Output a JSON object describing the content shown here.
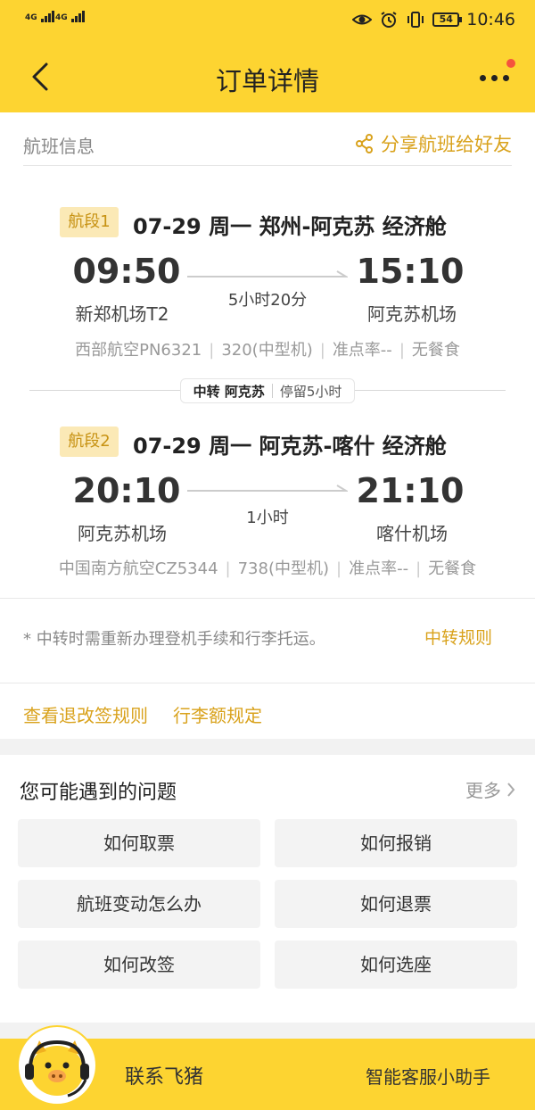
{
  "status_bar": {
    "signal_1": "4G",
    "signal_2": "4G",
    "battery": "54",
    "time": "10:46",
    "icons": [
      "eye-icon",
      "alarm-icon",
      "vibrate-icon"
    ]
  },
  "header": {
    "title": "订单详情"
  },
  "flight_info": {
    "title": "航班信息",
    "share_label": "分享航班给好友"
  },
  "segments": [
    {
      "badge": "航段1",
      "headline": "07-29  周一  郑州-阿克苏  经济舱",
      "dep_time": "09:50",
      "dep_airport": "新郑机场T2",
      "arr_time": "15:10",
      "arr_airport": "阿克苏机场",
      "duration": "5小时20分",
      "airline": "西部航空PN6321",
      "aircraft": "320(中型机)",
      "on_time": "准点率--",
      "meal": "无餐食"
    },
    {
      "badge": "航段2",
      "headline": "07-29  周一  阿克苏-喀什  经济舱",
      "dep_time": "20:10",
      "dep_airport": "阿克苏机场",
      "arr_time": "21:10",
      "arr_airport": "喀什机场",
      "duration": "1小时",
      "airline": "中国南方航空CZ5344",
      "aircraft": "738(中型机)",
      "on_time": "准点率--",
      "meal": "无餐食"
    }
  ],
  "transfer": {
    "label": "中转 阿克苏",
    "stay": "停留5小时"
  },
  "notice": {
    "text": "* 中转时需重新办理登机手续和行李托运。",
    "rule_link": "中转规则"
  },
  "rules": {
    "refund_change": "查看退改签规则",
    "baggage": "行李额规定"
  },
  "faq": {
    "title": "您可能遇到的问题",
    "more": "更多",
    "items": [
      "如何取票",
      "如何报销",
      "航班变动怎么办",
      "如何退票",
      "如何改签",
      "如何选座"
    ]
  },
  "footer": {
    "contact": "联系飞猪",
    "assistant": "智能客服小助手"
  },
  "colors": {
    "brand_yellow": "#fdd431",
    "accent_gold": "#d9a21c",
    "badge_bg": "#fbe9b6"
  }
}
